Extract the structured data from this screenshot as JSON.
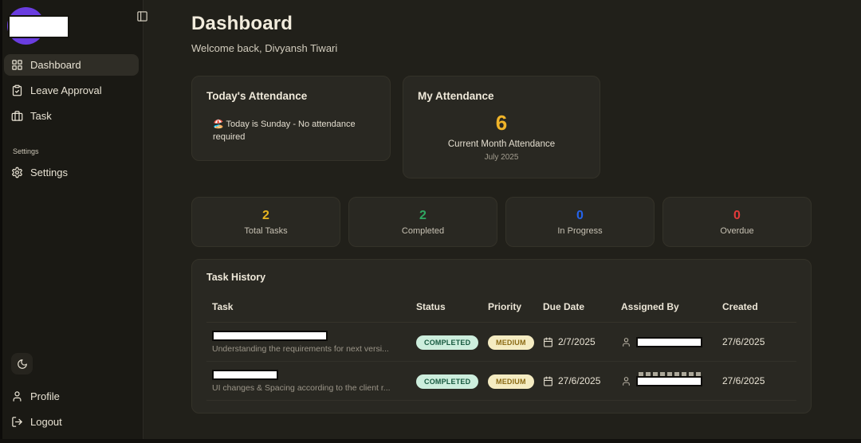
{
  "colors": {
    "accent_purple": "#6a3de0",
    "attendance_count": "#f0b429",
    "stat_total": "#e7b41f",
    "stat_completed": "#2fa862",
    "stat_in_progress": "#2563eb",
    "stat_overdue": "#e23a3a",
    "badge_completed_bg": "#cdeedd",
    "badge_completed_text": "#17593f",
    "badge_medium_bg": "#f5ecc2",
    "badge_medium_text": "#8b6a14"
  },
  "sidebar": {
    "nav": [
      {
        "label": "Dashboard",
        "icon": "grid-icon",
        "active": true
      },
      {
        "label": "Leave Approval",
        "icon": "clipboard-check-icon",
        "active": false
      },
      {
        "label": "Task",
        "icon": "briefcase-icon",
        "active": false
      }
    ],
    "section_label": "Settings",
    "settings_item": {
      "label": "Settings",
      "icon": "gear-icon"
    },
    "footer": {
      "profile_label": "Profile",
      "logout_label": "Logout"
    }
  },
  "header": {
    "title": "Dashboard",
    "subtitle": "Welcome back, Divyansh Tiwari"
  },
  "attendance": {
    "today": {
      "title": "Today's Attendance",
      "message": "🏖️ Today is Sunday - No attendance required"
    },
    "month": {
      "title": "My Attendance",
      "count": "6",
      "label": "Current Month Attendance",
      "period": "July 2025"
    }
  },
  "stats": [
    {
      "value": "2",
      "label": "Total Tasks"
    },
    {
      "value": "2",
      "label": "Completed"
    },
    {
      "value": "0",
      "label": "In Progress"
    },
    {
      "value": "0",
      "label": "Overdue"
    }
  ],
  "task_history": {
    "title": "Task History",
    "columns": [
      "Task",
      "Status",
      "Priority",
      "Due Date",
      "Assigned By",
      "Created"
    ],
    "rows": [
      {
        "subtitle": "Understanding the requirements for next versi...",
        "status": "COMPLETED",
        "priority": "MEDIUM",
        "due_date": "2/7/2025",
        "created": "27/6/2025"
      },
      {
        "subtitle": "UI changes & Spacing according to the client r...",
        "status": "COMPLETED",
        "priority": "MEDIUM",
        "due_date": "27/6/2025",
        "created": "27/6/2025"
      }
    ]
  }
}
